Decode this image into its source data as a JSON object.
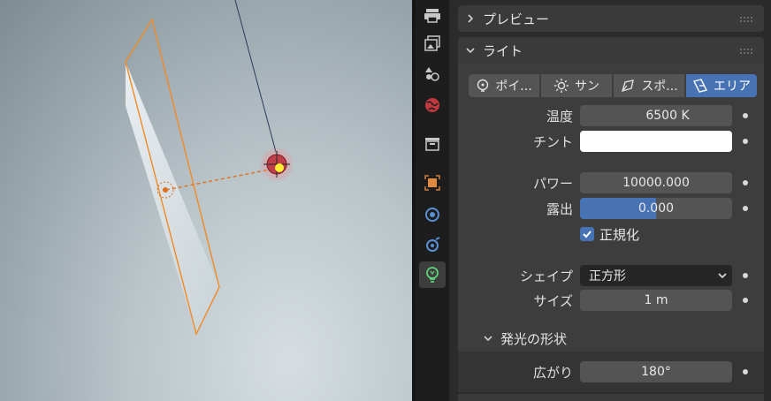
{
  "panels": {
    "preview": {
      "title": "プレビュー"
    },
    "light": {
      "title": "ライト"
    }
  },
  "light_types": [
    {
      "label": "ポイ...",
      "icon": "point-light-icon",
      "active": false
    },
    {
      "label": "サン",
      "icon": "sun-light-icon",
      "active": false
    },
    {
      "label": "スポ...",
      "icon": "spot-light-icon",
      "active": false
    },
    {
      "label": "エリア",
      "icon": "area-light-icon",
      "active": true
    }
  ],
  "properties": {
    "temperature": {
      "label": "温度",
      "value": "6500 K",
      "checked": true
    },
    "tint": {
      "label": "チント",
      "color": "#ffffff"
    },
    "power": {
      "label": "パワー",
      "value": "10000.000"
    },
    "exposure": {
      "label": "露出",
      "value": "0.000",
      "fill": 0.5
    },
    "normalize": {
      "label": "正規化",
      "checked": true
    },
    "shape": {
      "label": "シェイプ",
      "value": "正方形"
    },
    "size": {
      "label": "サイズ",
      "value": "1 m"
    }
  },
  "beam_shape": {
    "title": "発光の形状",
    "spread": {
      "label": "広がり",
      "value": "180°"
    }
  },
  "colors": {
    "accent": "#4772b3",
    "light_outline": "#f08a24",
    "active_tab_icon": "#5fd07a"
  }
}
